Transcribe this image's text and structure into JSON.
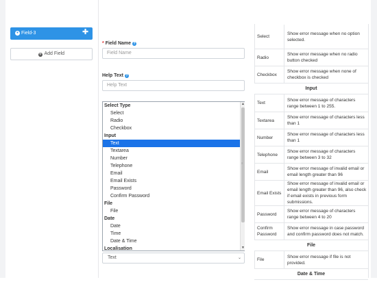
{
  "sidebar": {
    "field_item_label": "Field-3",
    "add_field_label": "Add Field"
  },
  "form": {
    "field_name_label": "Field Name",
    "field_name_required": "*",
    "field_name_placeholder": "Field Name",
    "help_text_label": "Help Text",
    "help_text_placeholder": "Help Text",
    "select_value": "Text"
  },
  "type_dropdown": {
    "rows": [
      {
        "text": "Select Type",
        "kind": "group"
      },
      {
        "text": "Select",
        "kind": "opt"
      },
      {
        "text": "Radio",
        "kind": "opt"
      },
      {
        "text": "Checkbox",
        "kind": "opt"
      },
      {
        "text": "Input",
        "kind": "group"
      },
      {
        "text": "Text",
        "kind": "opt",
        "selected": true
      },
      {
        "text": "Textarea",
        "kind": "opt"
      },
      {
        "text": "Number",
        "kind": "opt"
      },
      {
        "text": "Telephone",
        "kind": "opt"
      },
      {
        "text": "Email",
        "kind": "opt"
      },
      {
        "text": "Email Exists",
        "kind": "opt"
      },
      {
        "text": "Password",
        "kind": "opt"
      },
      {
        "text": "Confirm Password",
        "kind": "opt"
      },
      {
        "text": "File",
        "kind": "group"
      },
      {
        "text": "File",
        "kind": "opt"
      },
      {
        "text": "Date",
        "kind": "group"
      },
      {
        "text": "Date",
        "kind": "opt"
      },
      {
        "text": "Time",
        "kind": "opt"
      },
      {
        "text": "Date & Time",
        "kind": "opt"
      },
      {
        "text": "Localisation",
        "kind": "group"
      }
    ]
  },
  "validation_table": {
    "rows": [
      {
        "type": "Select",
        "desc": "Show error message when no option selected."
      },
      {
        "type": "Radio",
        "desc": "Show error message when no radio button checked"
      },
      {
        "type": "Checkbox",
        "desc": "Show error message when none of checkbox is checked"
      },
      {
        "header": "Input"
      },
      {
        "type": "Text",
        "desc": "Show error message of characters range between 1 to 255."
      },
      {
        "type": "Textarea",
        "desc": "Show error message of characters less than 1"
      },
      {
        "type": "Number",
        "desc": "Show error message of characters less than 1"
      },
      {
        "type": "Telephone",
        "desc": "Show error message of characters range between 3 to 32"
      },
      {
        "type": "Email",
        "desc": "Show error message of invalid email or email length greater than 96"
      },
      {
        "type": "Email Exists",
        "desc": "Show error message of invalid email or email length greater than 96, also check if email exists in previous form submissions."
      },
      {
        "type": "Password",
        "desc": "Show error message of characters range between 4 to 20"
      },
      {
        "type": "Confirm Password",
        "desc": "Show error message in case password and confirm password does not match."
      },
      {
        "header": "File"
      },
      {
        "type": "File",
        "desc": "Show error message if file is not provided."
      },
      {
        "header": "Date & Time"
      }
    ]
  }
}
